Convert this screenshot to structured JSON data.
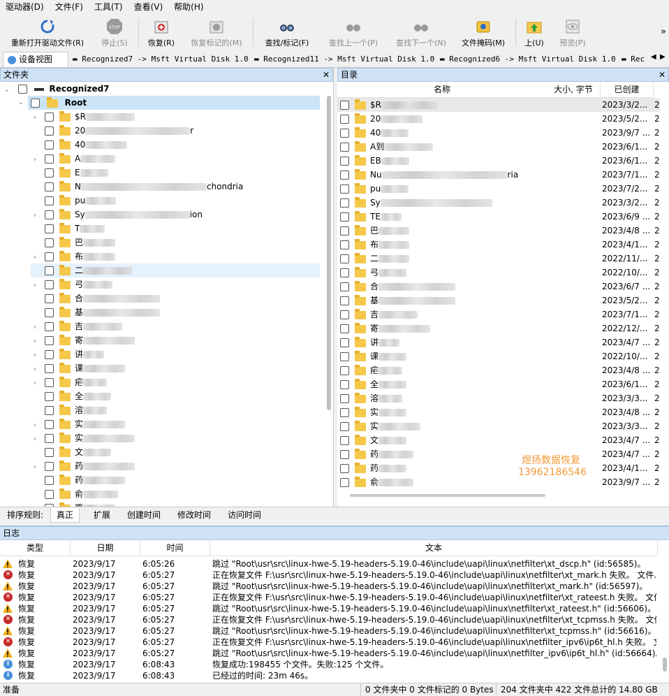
{
  "menu": [
    "驱动器(D)",
    "文件(F)",
    "工具(T)",
    "查看(V)",
    "帮助(H)"
  ],
  "toolbar": {
    "reopen": "重新打开驱动文件(R)",
    "stop": "停止(S)",
    "restore": "恢复(R)",
    "restore_marked": "恢复标记的(M)",
    "find_mark": "查找/标记(F)",
    "find_prev": "查找上一个(P)",
    "find_next": "查找下一个(N)",
    "file_mask": "文件掩码(M)",
    "up": "上(U)",
    "preview": "预览(P)",
    "more": "»"
  },
  "tabs": [
    "设备视图",
    "Recognized7 -> Msft Virtual Disk 1.0",
    "Recognized11 -> Msft Virtual Disk 1.0",
    "Recognized6 -> Msft Virtual Disk 1.0",
    "Rec"
  ],
  "folder_pane": {
    "title": "文件夹",
    "root_device": "Recognized7",
    "root": "Root",
    "items": [
      {
        "label": "$R",
        "exp": true
      },
      {
        "label": "20",
        "suffix": "r",
        "exp": false
      },
      {
        "label": "40",
        "exp": false
      },
      {
        "label": "A",
        "exp": true
      },
      {
        "label": "E",
        "exp": false
      },
      {
        "label": "N",
        "suffix": "chondria",
        "exp": false
      },
      {
        "label": "pu",
        "exp": false
      },
      {
        "label": "Sy",
        "suffix": "ion",
        "exp": true
      },
      {
        "label": "T",
        "exp": false
      },
      {
        "label": "巴",
        "exp": false
      },
      {
        "label": "布",
        "exp": true
      },
      {
        "label": "二",
        "exp": false
      },
      {
        "label": "弓",
        "exp": true
      },
      {
        "label": "合",
        "exp": false
      },
      {
        "label": "基",
        "exp": false
      },
      {
        "label": "吉",
        "exp": true
      },
      {
        "label": "寄",
        "exp": true
      },
      {
        "label": "讲",
        "exp": true
      },
      {
        "label": "课",
        "exp": true
      },
      {
        "label": "疟",
        "exp": true
      },
      {
        "label": "全",
        "exp": false
      },
      {
        "label": "溶",
        "exp": false
      },
      {
        "label": "实",
        "exp": true
      },
      {
        "label": "实",
        "exp": true
      },
      {
        "label": "文",
        "exp": false
      },
      {
        "label": "药",
        "exp": true
      },
      {
        "label": "药",
        "exp": false
      },
      {
        "label": "俞",
        "exp": false
      },
      {
        "label": "原",
        "exp": false
      }
    ]
  },
  "dir_pane": {
    "title": "目录",
    "columns": [
      "名称",
      "大小, 字节",
      "已创建"
    ],
    "rows": [
      {
        "name": "$R",
        "date": "2023/3/2...",
        "c2": "2"
      },
      {
        "name": "20",
        "date": "2023/5/2...",
        "c2": "2"
      },
      {
        "name": "40",
        "date": "2023/9/7 ...",
        "c2": "2"
      },
      {
        "name": "A到",
        "date": "2023/6/1...",
        "c2": "2"
      },
      {
        "name": "EB",
        "date": "2023/6/1...",
        "c2": "2"
      },
      {
        "name": "Nu",
        "suffix": "ria",
        "date": "2023/7/1...",
        "c2": "2"
      },
      {
        "name": "pu",
        "date": "2023/7/2...",
        "c2": "2"
      },
      {
        "name": "Sy",
        "date": "2023/3/2...",
        "c2": "2"
      },
      {
        "name": "TE",
        "date": "2023/6/9 ...",
        "c2": "2"
      },
      {
        "name": "巴",
        "date": "2023/4/8 ...",
        "c2": "2"
      },
      {
        "name": "布",
        "date": "2023/4/1...",
        "c2": "2"
      },
      {
        "name": "二",
        "date": "2022/11/...",
        "c2": "2"
      },
      {
        "name": "弓",
        "date": "2022/10/...",
        "c2": "2"
      },
      {
        "name": "合",
        "date": "2023/6/7 ...",
        "c2": "2"
      },
      {
        "name": "基",
        "date": "2023/5/2...",
        "c2": "2"
      },
      {
        "name": "吉",
        "date": "2023/7/1...",
        "c2": "2"
      },
      {
        "name": "寄",
        "date": "2022/12/...",
        "c2": "2"
      },
      {
        "name": "讲",
        "date": "2023/4/7 ...",
        "c2": "2"
      },
      {
        "name": "课",
        "date": "2022/10/...",
        "c2": "2"
      },
      {
        "name": "疟",
        "date": "2023/4/8 ...",
        "c2": "2"
      },
      {
        "name": "全",
        "date": "2023/6/1...",
        "c2": "2"
      },
      {
        "name": "溶",
        "date": "2023/3/3...",
        "c2": "2"
      },
      {
        "name": "实",
        "date": "2023/4/8 ...",
        "c2": "2"
      },
      {
        "name": "实",
        "date": "2023/3/3...",
        "c2": "2"
      },
      {
        "name": "文",
        "date": "2023/4/7 ...",
        "c2": "2"
      },
      {
        "name": "药",
        "date": "2023/4/7 ...",
        "c2": "2"
      },
      {
        "name": "药",
        "date": "2023/4/1...",
        "c2": "2"
      },
      {
        "name": "俞",
        "date": "2023/9/7 ...",
        "c2": "2"
      }
    ],
    "watermark_name": "煜扬数据恢复",
    "watermark_phone": "13962186546"
  },
  "sort_bar": {
    "label": "排序规则:",
    "options": [
      "真正",
      "扩展",
      "创建时间",
      "修改时间",
      "访问时间"
    ]
  },
  "log": {
    "title": "日志",
    "columns": [
      "类型",
      "日期",
      "时间",
      "文本"
    ],
    "rows": [
      {
        "icon": "warn",
        "type": "恢复",
        "date": "2023/9/17",
        "time": "6:05:26",
        "text": "跳过 \"Root\\usr\\src\\linux-hwe-5.19-headers-5.19.0-46\\include\\uapi\\linux\\netfilter\\xt_dscp.h\" (id:56585)。"
      },
      {
        "icon": "error",
        "type": "恢复",
        "date": "2023/9/17",
        "time": "6:05:27",
        "text": "正在恢复文件 F:\\usr\\src\\linux-hwe-5.19-headers-5.19.0-46\\include\\uapi\\linux\\netfilter\\xt_mark.h 失败。 文件..."
      },
      {
        "icon": "warn",
        "type": "恢复",
        "date": "2023/9/17",
        "time": "6:05:27",
        "text": "跳过 \"Root\\usr\\src\\linux-hwe-5.19-headers-5.19.0-46\\include\\uapi\\linux\\netfilter\\xt_mark.h\" (id:56597)。"
      },
      {
        "icon": "error",
        "type": "恢复",
        "date": "2023/9/17",
        "time": "6:05:27",
        "text": "正在恢复文件 F:\\usr\\src\\linux-hwe-5.19-headers-5.19.0-46\\include\\uapi\\linux\\netfilter\\xt_rateest.h 失败。 文件..."
      },
      {
        "icon": "warn",
        "type": "恢复",
        "date": "2023/9/17",
        "time": "6:05:27",
        "text": "跳过 \"Root\\usr\\src\\linux-hwe-5.19-headers-5.19.0-46\\include\\uapi\\linux\\netfilter\\xt_rateest.h\" (id:56606)。"
      },
      {
        "icon": "error",
        "type": "恢复",
        "date": "2023/9/17",
        "time": "6:05:27",
        "text": "正在恢复文件 F:\\usr\\src\\linux-hwe-5.19-headers-5.19.0-46\\include\\uapi\\linux\\netfilter\\xt_tcpmss.h 失败。 文件..."
      },
      {
        "icon": "warn",
        "type": "恢复",
        "date": "2023/9/17",
        "time": "6:05:27",
        "text": "跳过 \"Root\\usr\\src\\linux-hwe-5.19-headers-5.19.0-46\\include\\uapi\\linux\\netfilter\\xt_tcpmss.h\" (id:56616)。"
      },
      {
        "icon": "error",
        "type": "恢复",
        "date": "2023/9/17",
        "time": "6:05:27",
        "text": "正在恢复文件 F:\\usr\\src\\linux-hwe-5.19-headers-5.19.0-46\\include\\uapi\\linux\\netfilter_ipv6\\ip6t_hl.h 失败。 文..."
      },
      {
        "icon": "warn",
        "type": "恢复",
        "date": "2023/9/17",
        "time": "6:05:27",
        "text": "跳过 \"Root\\usr\\src\\linux-hwe-5.19-headers-5.19.0-46\\include\\uapi\\linux\\netfilter_ipv6\\ip6t_hl.h\" (id:56664)。"
      },
      {
        "icon": "info",
        "type": "恢复",
        "date": "2023/9/17",
        "time": "6:08:43",
        "text": "恢复成功:198455 个文件。失败:125 个文件。"
      },
      {
        "icon": "info",
        "type": "恢复",
        "date": "2023/9/17",
        "time": "6:08:43",
        "text": "已经过的时间: 23m 46s。"
      }
    ]
  },
  "status": {
    "ready": "准备",
    "marked": "0 文件夹中 0 文件标记的 0 Bytes",
    "total": "204 文件夹中 422 文件总计的 14.80 GB"
  },
  "colors": {
    "selection": "#cce4f7",
    "folder": "#f5c84a",
    "watermark": "#f29a38",
    "pane_header": "#cfe2f5"
  }
}
